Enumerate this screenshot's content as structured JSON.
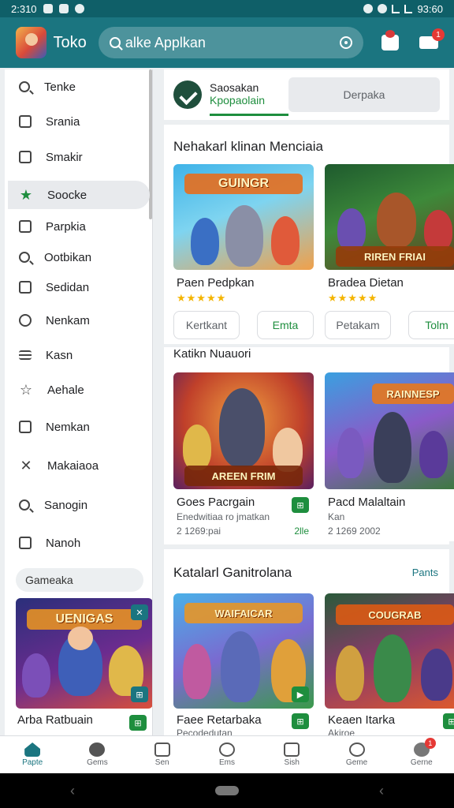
{
  "status_bar": {
    "time": "2:310",
    "right_text": "93:60"
  },
  "app_bar": {
    "title": "Toko",
    "search_text": "alke Applkan",
    "cart_badge": "1"
  },
  "drawer": {
    "items": [
      {
        "label": "Tenke",
        "icon": "search-icon"
      },
      {
        "label": "Srania",
        "icon": "chart-icon"
      },
      {
        "label": "Smakir",
        "icon": "bag-icon"
      },
      {
        "label": "Soocke",
        "icon": "star-icon"
      },
      {
        "label": "Parpkia",
        "icon": "doc-icon"
      },
      {
        "label": "Ootbikan",
        "icon": "search-icon"
      },
      {
        "label": "Sedidan",
        "icon": "grid-icon"
      },
      {
        "label": "Nenkam",
        "icon": "clock-icon"
      },
      {
        "label": "Kasn",
        "icon": "list-icon"
      },
      {
        "label": "Aehale",
        "icon": "star-outline-icon"
      },
      {
        "label": "Nemkan",
        "icon": "home-icon"
      },
      {
        "label": "Makaiaoa",
        "icon": "tools-icon"
      },
      {
        "label": "Sanogin",
        "icon": "search-icon"
      },
      {
        "label": "Nanoh",
        "icon": "inbox-icon"
      }
    ],
    "chip_label": "Gameaka",
    "card": {
      "name": "Arba Ratbuain",
      "art_title": "UENIGAS"
    }
  },
  "tabs": {
    "active_line1": "Saosakan",
    "active_line2": "Kpopaolain",
    "inactive": "Derpaka"
  },
  "section1": {
    "title": "Nehakarl klinan Menciaia",
    "cards": [
      {
        "name": "Paen Pedpkan",
        "art_title": "GUINGR",
        "button": "Kertkant",
        "button2": "Emta"
      },
      {
        "name": "Bradea Dietan",
        "art_title": "RIREN FRIAI",
        "button": "Petakam",
        "button2": "Tolm"
      }
    ]
  },
  "section2": {
    "title": "Katikn Nuauori",
    "cards": [
      {
        "name": "Goes Pacrgain",
        "sub1": "Enedwitiaa ro jmatkan",
        "sub2": "2 1269:pai",
        "badge_text": "2lle",
        "art_title": "AREEN FRIM"
      },
      {
        "name": "Pacd Malaltain",
        "sub1": "Kan",
        "sub2": "2 1269 2002",
        "art_title": "RAINNESP"
      }
    ]
  },
  "section3": {
    "title": "Katalarl Ganitrolana",
    "more": "Pants",
    "cards": [
      {
        "name": "Faee Retarbaka",
        "sub": "Pecodedutan",
        "art_title": "WAIFAICAR"
      },
      {
        "name": "Keaen Itarka",
        "sub": "Akiroe",
        "art_title": "COUGRAB"
      }
    ]
  },
  "bottom_nav": [
    {
      "label": "Papte",
      "icon": "home-icon",
      "active": true
    },
    {
      "label": "Gems",
      "icon": "chat-icon"
    },
    {
      "label": "Sen",
      "icon": "window-icon"
    },
    {
      "label": "Ems",
      "icon": "search-icon"
    },
    {
      "label": "Sish",
      "icon": "camera-icon"
    },
    {
      "label": "Geme",
      "icon": "search-icon"
    },
    {
      "label": "Gerne",
      "icon": "user-icon",
      "badge": "1"
    }
  ],
  "colors": {
    "primary": "#1b7580",
    "accent_green": "#1e8e3e",
    "badge_red": "#e53935"
  }
}
